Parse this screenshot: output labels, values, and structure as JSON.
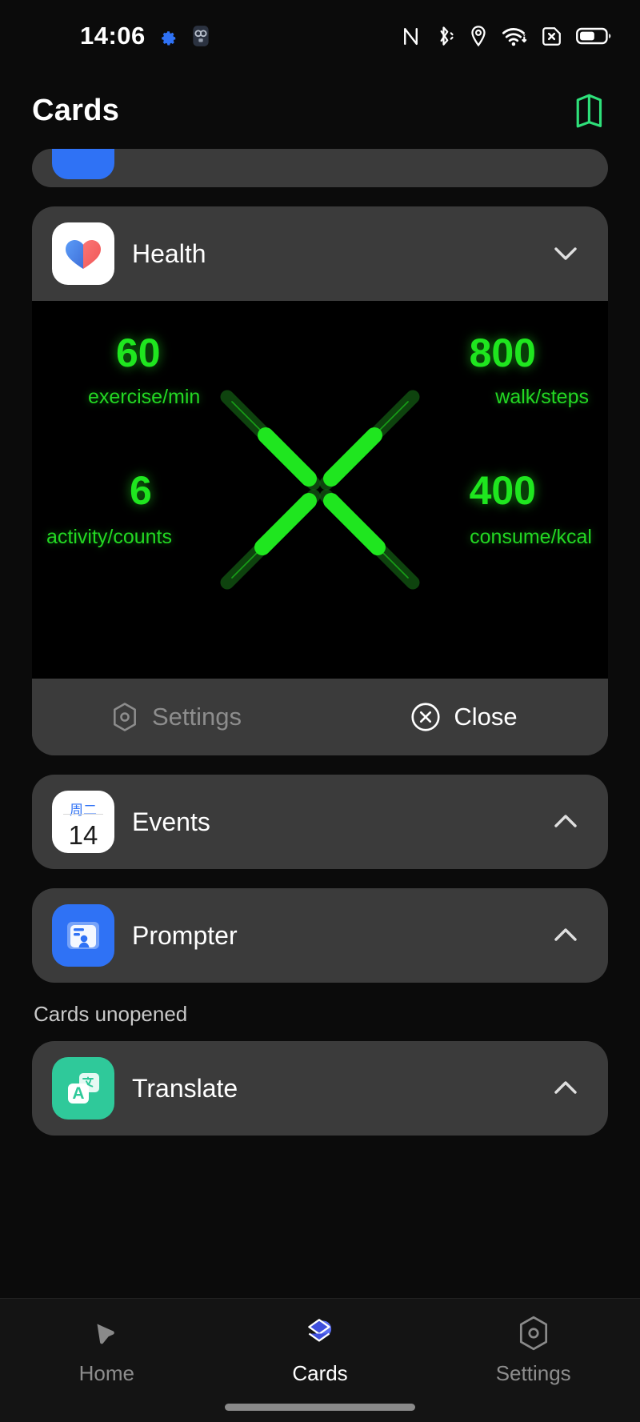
{
  "statusbar": {
    "time": "14:06",
    "left_icons": [
      {
        "name": "gear-icon",
        "color": "#2f72f5"
      },
      {
        "name": "glasses-device-icon",
        "color": "#6d7684"
      }
    ],
    "right_icons": [
      {
        "name": "nfc-icon"
      },
      {
        "name": "bluetooth-icon"
      },
      {
        "name": "location-icon"
      },
      {
        "name": "wifi-icon"
      },
      {
        "name": "sim-disabled-icon"
      },
      {
        "name": "battery-icon",
        "level_percent": 55
      }
    ]
  },
  "header": {
    "title": "Cards",
    "action_icon": "cards-stack-icon",
    "action_icon_color": "#2ee07a"
  },
  "cards": [
    {
      "id": "peek",
      "label": "",
      "icon": "blue-app-icon",
      "icon_bg": "#2f72f5",
      "state": "partial"
    },
    {
      "id": "health",
      "label": "Health",
      "icon": "health-heart-icon",
      "icon_bg": "#ffffff",
      "chevron": "chevron-down",
      "expanded": true,
      "actions": [
        {
          "label": "Settings",
          "icon": "hexagon-gear-icon",
          "style": "dim"
        },
        {
          "label": "Close",
          "icon": "close-circle-icon",
          "style": "bright"
        }
      ]
    },
    {
      "id": "events",
      "label": "Events",
      "icon": "calendar-icon",
      "icon_bg": "#ffffff",
      "icon_weekday": "周二",
      "icon_day": "14",
      "chevron": "chevron-up",
      "expanded": false
    },
    {
      "id": "prompter",
      "label": "Prompter",
      "icon": "prompter-card-icon",
      "icon_bg": "#2f72f5",
      "chevron": "chevron-up",
      "expanded": false
    }
  ],
  "unopened_section": {
    "label": "Cards unopened",
    "cards": [
      {
        "id": "translate",
        "label": "Translate",
        "icon": "translate-icon",
        "icon_bg": "#2fc99a",
        "icon_letter": "A",
        "chevron": "chevron-up",
        "expanded": false
      }
    ]
  },
  "chart_data": {
    "type": "gauge",
    "title": "Health",
    "accent_color": "#1fe61f",
    "background": "#000000",
    "metrics": [
      {
        "position": "top-left",
        "value": 60,
        "unit": "exercise/min",
        "fill_ratio": 0.55
      },
      {
        "position": "top-right",
        "value": 800,
        "unit": "walk/steps",
        "fill_ratio": 0.55
      },
      {
        "position": "bottom-left",
        "value": 6,
        "unit": "activity/counts",
        "fill_ratio": 0.62
      },
      {
        "position": "bottom-right",
        "value": 400,
        "unit": "consume/kcal",
        "fill_ratio": 0.62
      }
    ]
  },
  "navbar": {
    "items": [
      {
        "label": "Home",
        "icon": "home-pen-icon",
        "active": false
      },
      {
        "label": "Cards",
        "icon": "cards-layers-icon",
        "active": true
      },
      {
        "label": "Settings",
        "icon": "hexagon-gear-icon",
        "active": false
      }
    ]
  }
}
